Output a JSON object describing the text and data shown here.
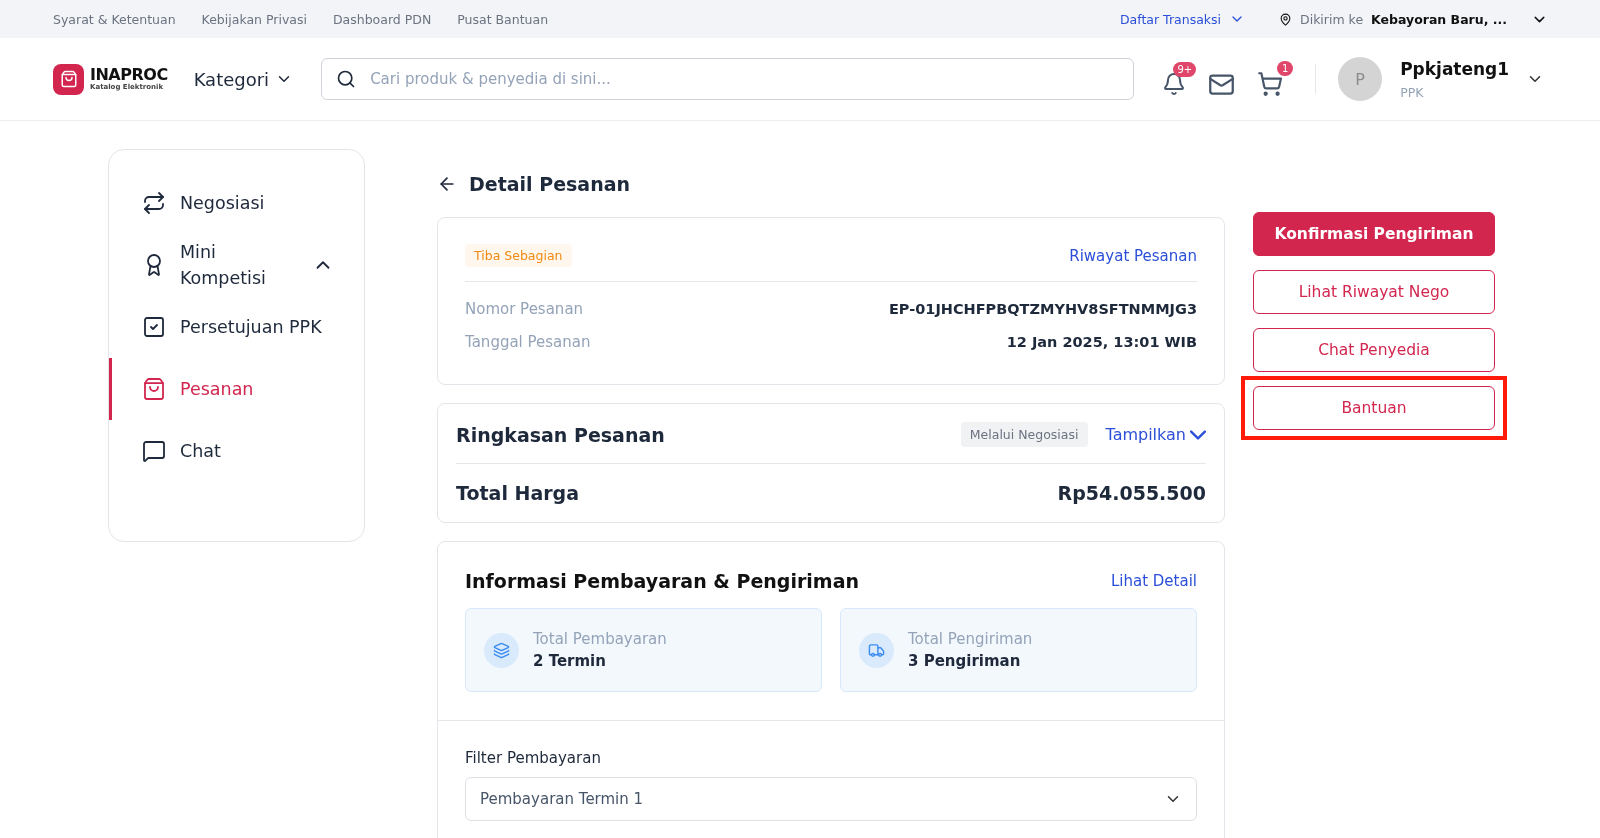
{
  "top_links": [
    "Syarat & Ketentuan",
    "Kebijakan Privasi",
    "Dashboard PDN",
    "Pusat Bantuan"
  ],
  "transactions_menu": "Daftar Transaksi",
  "delivery": {
    "label": "Dikirim ke",
    "location": "Kebayoran Baru, ..."
  },
  "logo": {
    "name": "INAPROC",
    "tagline": "Katalog Elektronik"
  },
  "category_menu": "Kategori",
  "search": {
    "placeholder": "Cari produk & penyedia di sini..."
  },
  "notification_badge": "9+",
  "cart_badge": "1",
  "user": {
    "initial": "P",
    "name": "Ppkjateng1",
    "role": "PPK"
  },
  "sidebar": {
    "items": [
      {
        "label": "Negosiasi",
        "selected": false
      },
      {
        "label": "Mini Kompetisi",
        "selected": false,
        "expanded": true
      },
      {
        "label": "Persetujuan PPK",
        "selected": false
      },
      {
        "label": "Pesanan",
        "selected": true
      },
      {
        "label": "Chat",
        "selected": false
      }
    ]
  },
  "page_title": "Detail Pesanan",
  "order": {
    "status": "Tiba Sebagian",
    "history_link": "Riwayat Pesanan",
    "fields": [
      {
        "label": "Nomor Pesanan",
        "value": "EP-01JHCHFPBQTZMYHV8SFTNMMJG3"
      },
      {
        "label": "Tanggal Pesanan",
        "value": "12 Jan 2025, 13:01 WIB"
      }
    ]
  },
  "summary": {
    "title": "Ringkasan Pesanan",
    "tag": "Melalui Negosiasi",
    "toggle": "Tampilkan",
    "total_label": "Total Harga",
    "total_value": "Rp54.055.500"
  },
  "payment_info": {
    "title": "Informasi Pembayaran & Pengiriman",
    "link": "Lihat Detail",
    "stats": [
      {
        "label": "Total Pembayaran",
        "value": "2 Termin"
      },
      {
        "label": "Total Pengiriman",
        "value": "3 Pengiriman"
      }
    ],
    "filter_label": "Filter Pembayaran",
    "filter_value": "Pembayaran Termin 1"
  },
  "actions": [
    {
      "label": "Konfirmasi Pengiriman",
      "kind": "primary",
      "highlighted": false
    },
    {
      "label": "Lihat Riwayat Nego",
      "kind": "outline",
      "highlighted": false
    },
    {
      "label": "Chat Penyedia",
      "kind": "outline",
      "highlighted": false
    },
    {
      "label": "Bantuan",
      "kind": "outline",
      "highlighted": true
    }
  ]
}
